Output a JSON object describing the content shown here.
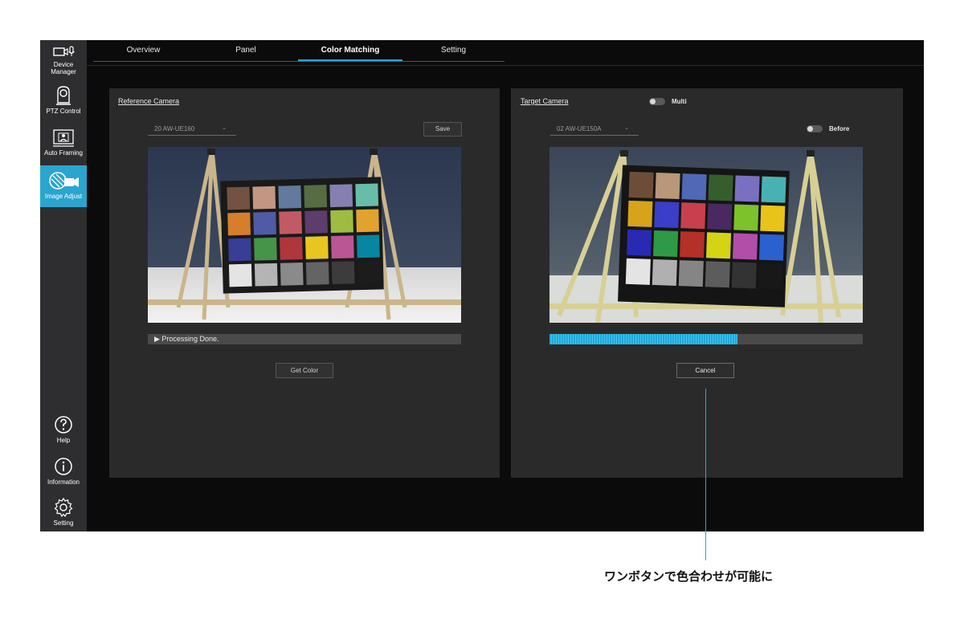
{
  "sidebar": {
    "items": [
      {
        "label": "Device\nManager",
        "icon": "device-manager-icon"
      },
      {
        "label": "PTZ Control",
        "icon": "ptz-camera-icon"
      },
      {
        "label": "Auto Framing",
        "icon": "auto-framing-icon"
      },
      {
        "label": "Image Adjust",
        "icon": "image-adjust-icon"
      }
    ],
    "bottom_items": [
      {
        "label": "Help",
        "icon": "help-icon"
      },
      {
        "label": "Information",
        "icon": "info-icon"
      },
      {
        "label": "Setting",
        "icon": "gear-icon"
      }
    ],
    "active_item": "Image Adjust"
  },
  "tabs": [
    {
      "label": "Overview"
    },
    {
      "label": "Panel"
    },
    {
      "label": "Color Matching"
    },
    {
      "label": "Setting"
    }
  ],
  "active_tab": "Color Matching",
  "reference": {
    "title": "Reference Camera",
    "camera_select": "20 AW-UE160",
    "save_label": "Save",
    "status": "Processing Done.",
    "get_color_label": "Get Color"
  },
  "target": {
    "title": "Target Camera",
    "multi_label": "Multi",
    "multi_on": false,
    "camera_select": "02 AW-UE150A",
    "before_label": "Before",
    "before_on": false,
    "progress": 0.6,
    "cancel_label": "Cancel"
  },
  "callout": {
    "text": "ワンボタンで色合わせが可能に"
  },
  "colors": {
    "accent": "#2aa5cf",
    "progress": "#1ea9d8",
    "app_bg": "#0b0b0b",
    "panel_bg": "#2a2a2b",
    "sidebar_bg": "#2e2e30"
  }
}
